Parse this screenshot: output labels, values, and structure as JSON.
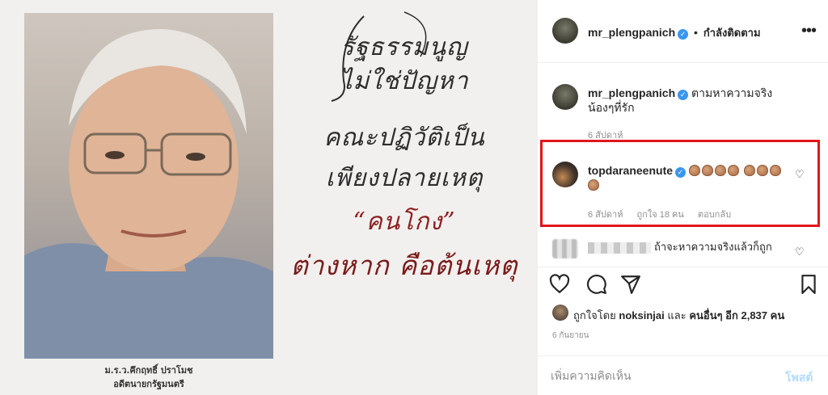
{
  "image": {
    "poem": [
      "รัฐธรรมนูญ",
      "ไม่ใช่ปัญหา",
      "คณะปฏิวัติเป็น",
      "เพียงปลายเหตุ",
      "“คนโกง”",
      "ต่างหาก คือต้นเหตุ"
    ],
    "caption_line1": "ม.ร.ว.คึกฤทธิ์ ปราโมช",
    "caption_line2": "อดีตนายกรัฐมนตรี"
  },
  "header": {
    "username": "mr_plengpanich",
    "follow_state": "กำลังติดตาม",
    "dot": "•",
    "more_icon": "more-horizontal-icon"
  },
  "comments": [
    {
      "username": "mr_plengpanich",
      "verified": true,
      "text": "ตามหาความจริง น้องๆที่รัก",
      "time": "6 สัปดาห์"
    },
    {
      "username": "topdaraneenute",
      "verified": true,
      "claps": 8,
      "time": "6 สัปดาห์",
      "likes": "ถูกใจ 18 คน",
      "reply": "ตอบกลับ"
    },
    {
      "text": "ถ้าจะหาความจริงแล้วก็ถูก"
    }
  ],
  "likes": {
    "prefix": "ถูกใจโดย",
    "first_user": "noksinjai",
    "and": "และ",
    "others": "คนอื่นๆ อีก 2,837 คน"
  },
  "post_date": "6 กันยายน",
  "add_comment": {
    "placeholder": "เพิ่มความคิดเห็น",
    "post_label": "โพสต์"
  },
  "colors": {
    "highlight": "#e0161b",
    "verified": "#3897f0",
    "post_button": "#b3dbff"
  }
}
